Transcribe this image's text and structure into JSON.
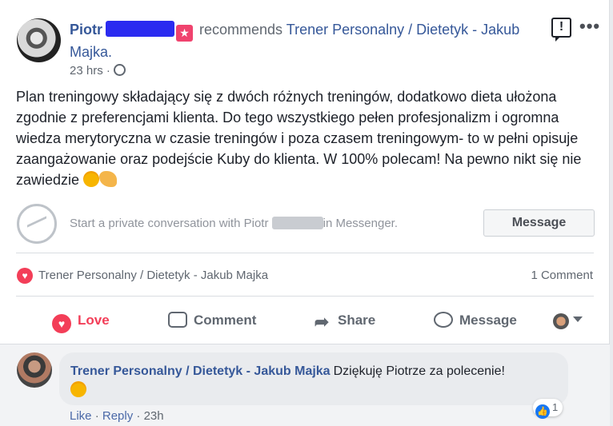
{
  "header": {
    "author": "Piotr",
    "recommends": "recommends",
    "page_name": "Trener Personalny / Dietetyk - Jakub Majka.",
    "time": "23 hrs ·"
  },
  "post": {
    "text": "Plan treningowy składający się z dwóch różnych treningów, dodatkowo dieta ułożona zgodnie z preferencjami klienta. Do tego wszystkiego pełen profesjonalizm i ogromna wiedza merytoryczna w czasie treningów i poza czasem treningowym- to w pełni opisuje zaangażowanie oraz podejście Kuby do klienta. W 100% polecam! Na pewno nikt się nie zawiedzie"
  },
  "messenger": {
    "prefix": "Start a private conversation with Piotr",
    "suffix": "in Messenger.",
    "button": "Message"
  },
  "reactions": {
    "name": "Trener Personalny / Dietetyk - Jakub Majka",
    "comments": "1 Comment"
  },
  "actions": {
    "love": "Love",
    "comment": "Comment",
    "share": "Share",
    "message": "Message"
  },
  "comment": {
    "author": "Trener Personalny / Dietetyk - Jakub Majka",
    "text": "Dziękuję Piotrze za polecenie!",
    "like_count": "1",
    "like": "Like",
    "sep1": "·",
    "reply": "Reply",
    "sep2": "·",
    "time": "23h"
  },
  "colors": {
    "link": "#365899",
    "love": "#f33e58",
    "redaction": "#2b2bf0"
  }
}
